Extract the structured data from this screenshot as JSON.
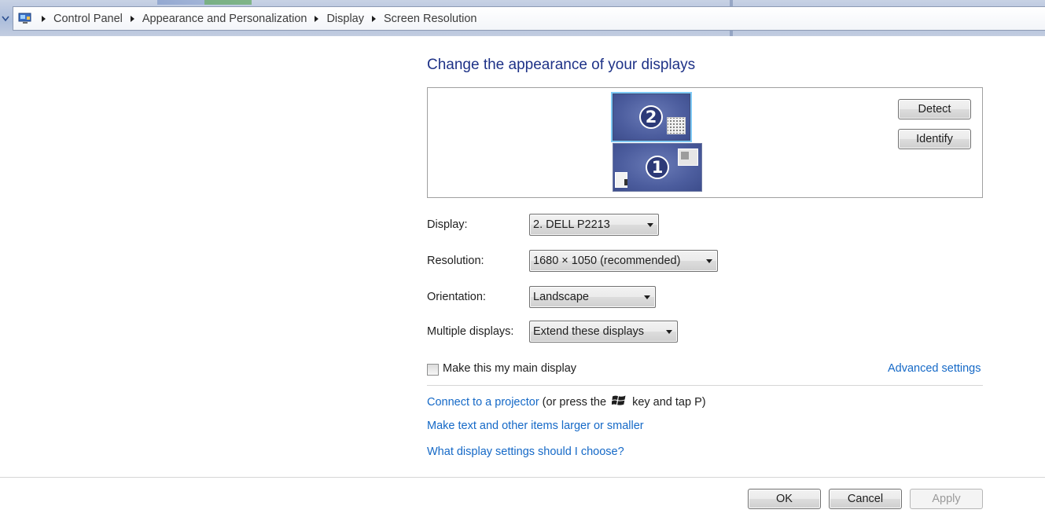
{
  "breadcrumb": {
    "items": [
      "Control Panel",
      "Appearance and Personalization",
      "Display",
      "Screen Resolution"
    ]
  },
  "main": {
    "heading": "Change the appearance of your displays",
    "preview": {
      "monitors": [
        {
          "label": "2",
          "selected": true
        },
        {
          "label": "1",
          "selected": false
        }
      ],
      "detect_label": "Detect",
      "identify_label": "Identify"
    },
    "form": {
      "display_label": "Display:",
      "display_value": "2. DELL P2213",
      "resolution_label": "Resolution:",
      "resolution_value": "1680 × 1050 (recommended)",
      "orientation_label": "Orientation:",
      "orientation_value": "Landscape",
      "multiple_label": "Multiple displays:",
      "multiple_value": "Extend these displays"
    },
    "main_display_checkbox": {
      "label": "Make this my main display",
      "checked": false
    },
    "advanced_settings_link": "Advanced settings",
    "projector": {
      "link": "Connect to a projector",
      "text_before_icon": "(or press the",
      "text_after_icon": "key and tap P)"
    },
    "text_size_link": "Make text and other items larger or smaller",
    "help_link": "What display settings should I choose?"
  },
  "footer": {
    "ok_label": "OK",
    "cancel_label": "Cancel",
    "apply_label": "Apply",
    "apply_enabled": false
  },
  "colors": {
    "heading": "#1e3287",
    "link": "#1569c7",
    "monitor_fill": "#4c5d9e",
    "selection_outline": "#7fc9f5"
  },
  "icons": [
    "chevron-down-icon",
    "control-panel-icon",
    "breadcrumb-arrow-icon",
    "dropdown-caret-icon",
    "windows-key-icon"
  ]
}
